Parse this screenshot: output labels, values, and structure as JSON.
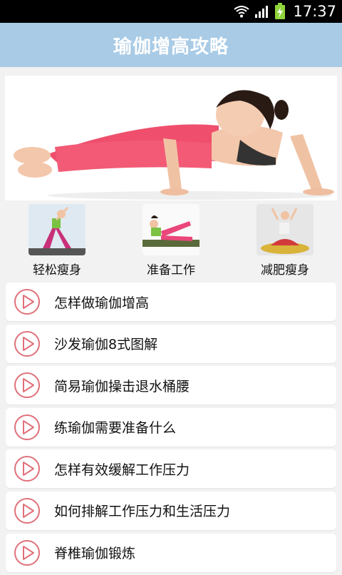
{
  "status_bar": {
    "time": "17:37"
  },
  "app": {
    "title": "瑜伽增高攻略"
  },
  "categories": [
    {
      "label": "轻松瘦身"
    },
    {
      "label": "准备工作"
    },
    {
      "label": "减肥瘦身"
    }
  ],
  "articles": [
    {
      "title": "怎样做瑜伽增高"
    },
    {
      "title": "沙发瑜伽8式图解"
    },
    {
      "title": "简易瑜伽操击退水桶腰"
    },
    {
      "title": "练瑜伽需要准备什么"
    },
    {
      "title": "怎样有效缓解工作压力"
    },
    {
      "title": "如何排解工作压力和生活压力"
    },
    {
      "title": "脊椎瑜伽锻炼"
    }
  ],
  "colors": {
    "header": "#a9cbe6",
    "accent": "#e0707a",
    "background": "#f2f2f2"
  },
  "icons": [
    "wifi-icon",
    "signal-icon",
    "battery-icon",
    "play-icon"
  ]
}
